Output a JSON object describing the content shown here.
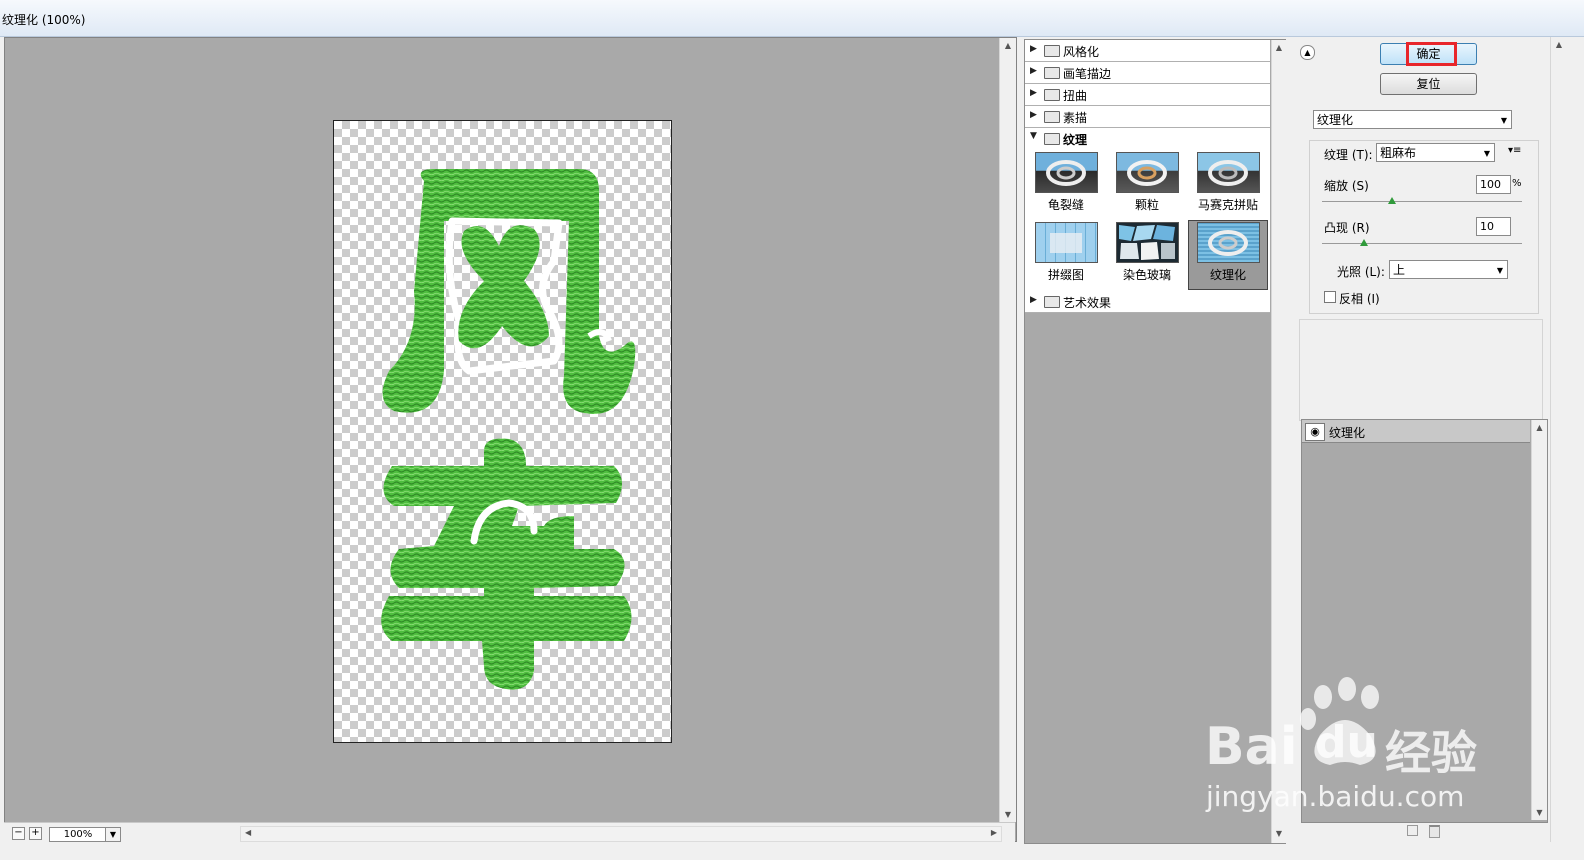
{
  "window": {
    "title": "纹理化 (100%)"
  },
  "preview": {
    "document_text": [
      "风",
      "车"
    ],
    "zoom": "100%",
    "zoom_out_glyph": "−",
    "zoom_in_glyph": "+",
    "fill_color": "#48b73a",
    "stroke_color": "#ffffff"
  },
  "filter_gallery": {
    "categories_top": [
      {
        "label": "风格化"
      },
      {
        "label": "画笔描边"
      },
      {
        "label": "扭曲"
      },
      {
        "label": "素描"
      }
    ],
    "open_category": {
      "label": "纹理"
    },
    "thumbnails": [
      {
        "label": "龟裂缝",
        "icon": "craquelure-thumb"
      },
      {
        "label": "颗粒",
        "icon": "grain-thumb"
      },
      {
        "label": "马赛克拼贴",
        "icon": "mosaic-tiles-thumb"
      },
      {
        "label": "拼缀图",
        "icon": "patchwork-thumb"
      },
      {
        "label": "染色玻璃",
        "icon": "stained-glass-thumb"
      },
      {
        "label": "纹理化",
        "icon": "texturizer-thumb",
        "selected": true
      }
    ],
    "categories_bottom": [
      {
        "label": "艺术效果"
      }
    ]
  },
  "controls": {
    "ok_label": "确定",
    "reset_label": "复位",
    "filter_select": "纹理化",
    "texture_label": "纹理 (T):",
    "texture_value": "粗麻布",
    "scale_label": "缩放 (S)",
    "scale_value": "100",
    "scale_unit": "%",
    "scale_fraction": 0.33,
    "relief_label": "凸现 (R)",
    "relief_value": "10",
    "relief_fraction": 0.2,
    "light_label": "光照 (L):",
    "light_value": "上",
    "invert_label": "反相 (I)",
    "invert_checked": false,
    "highlight_color": "#e8262b"
  },
  "layers": {
    "items": [
      {
        "label": "纹理化",
        "visible": true
      }
    ]
  },
  "watermark": {
    "brand_latin": "Bai",
    "brand_du": "du",
    "brand_cn": "经验",
    "url": "jingyan.baidu.com"
  }
}
